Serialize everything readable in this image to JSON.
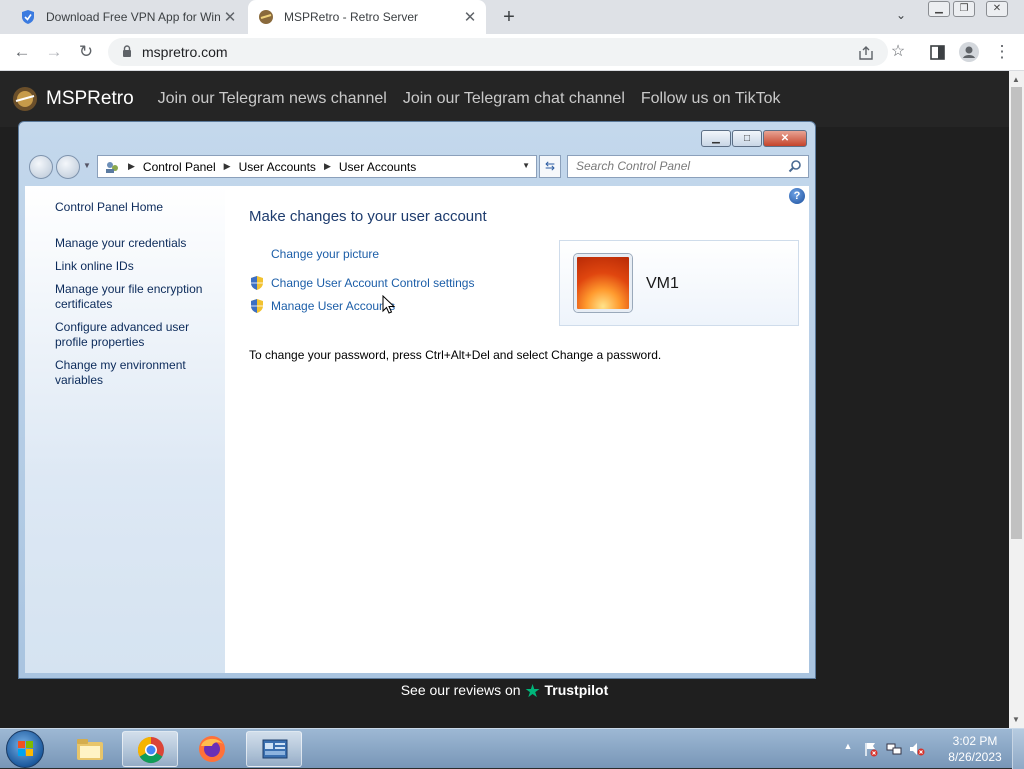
{
  "browser": {
    "tabs": [
      {
        "title": "Download Free VPN App for Win",
        "active": false
      },
      {
        "title": "MSPRetro - Retro Server",
        "active": true
      }
    ],
    "new_tab": "+",
    "url": "mspretro.com"
  },
  "site": {
    "name": "MSPRetro",
    "nav": [
      "Join our Telegram news channel",
      "Join our Telegram chat channel",
      "Follow us on TikTok"
    ],
    "trustpilot_prefix": "See our reviews on",
    "trustpilot_brand": "Trustpilot",
    "trustpilot_color": "#00b67a"
  },
  "window": {
    "breadcrumb": [
      "Control Panel",
      "User Accounts",
      "User Accounts"
    ],
    "search_placeholder": "Search Control Panel",
    "sidebar": {
      "home": "Control Panel Home",
      "items": [
        "Manage your credentials",
        "Link online IDs",
        "Manage your file encryption certificates",
        "Configure advanced user profile properties",
        "Change my environment variables"
      ]
    },
    "main": {
      "title": "Make changes to your user account",
      "links": [
        "Change your picture",
        "Change User Account Control settings",
        "Manage User Accounts"
      ],
      "password_note": "To change your password, press Ctrl+Alt+Del and select Change a password."
    },
    "user": {
      "name": "VM1"
    },
    "help": "?"
  },
  "taskbar": {
    "apps": [
      "windows-explorer",
      "google-chrome",
      "firefox",
      "control-panel"
    ],
    "clock": {
      "time": "3:02 PM",
      "date": "8/26/2023"
    }
  }
}
